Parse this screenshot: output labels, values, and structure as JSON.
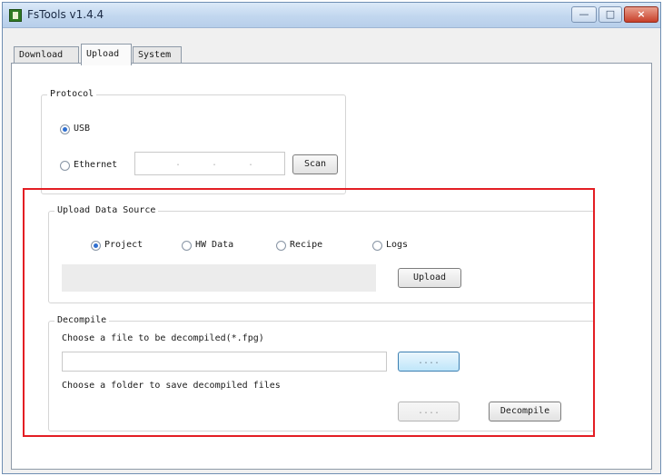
{
  "window": {
    "title": "FsTools v1.4.4",
    "minimize": "—",
    "maximize": "□",
    "close": "×"
  },
  "tabs": [
    "Download",
    "Upload",
    "System"
  ],
  "protocol": {
    "title": "Protocol",
    "usb_label": "USB",
    "ethernet_label": "Ethernet",
    "ip_separators": [
      ".",
      ".",
      "."
    ],
    "scan_label": "Scan",
    "selected": "USB"
  },
  "upload_source": {
    "title": "Upload Data Source",
    "options": [
      "Project",
      "HW Data",
      "Recipe",
      "Logs"
    ],
    "selected": "Project",
    "upload_label": "Upload"
  },
  "decompile": {
    "title": "Decompile",
    "file_prompt": "Choose a file to be decompiled(*.fpg)",
    "browse_file_label": "....",
    "folder_prompt": "Choose a folder to save decompiled files",
    "browse_folder_label": "....",
    "decompile_label": "Decompile"
  },
  "annotation": {
    "highlight_color": "#e31e24"
  }
}
